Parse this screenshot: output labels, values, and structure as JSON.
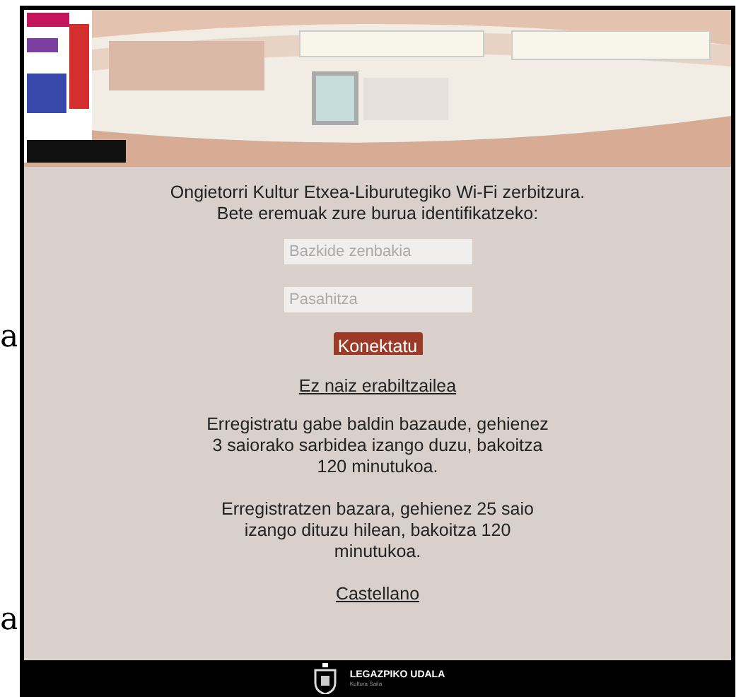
{
  "margin_texts": [
    "a",
    "a"
  ],
  "welcome": [
    "Ongietorri Kultur Etxea-Liburutegiko Wi-Fi zerbitzura.",
    "Bete eremuak zure burua identifikatzeko:"
  ],
  "fields": [
    {
      "placeholder": "Bazkide zenbakia"
    },
    {
      "placeholder": "Pasahitza"
    }
  ],
  "connect_button": "Konektatu",
  "guest_link": "Ez naiz erabiltzailea",
  "paragraphs": [
    "Erregistratu gabe baldin bazaude, gehienez 3 saiorako sarbidea izango duzu, bakoitza 120 minutukoa.",
    "Erregistratzen bazara, gehienez 25 saio izango dituzu hilean, bakoitza 120 minutukoa."
  ],
  "language_link": "Castellano",
  "footer": {
    "title": "LEGAZPIKO UDALA",
    "subtitle": "Kultura Saila"
  }
}
